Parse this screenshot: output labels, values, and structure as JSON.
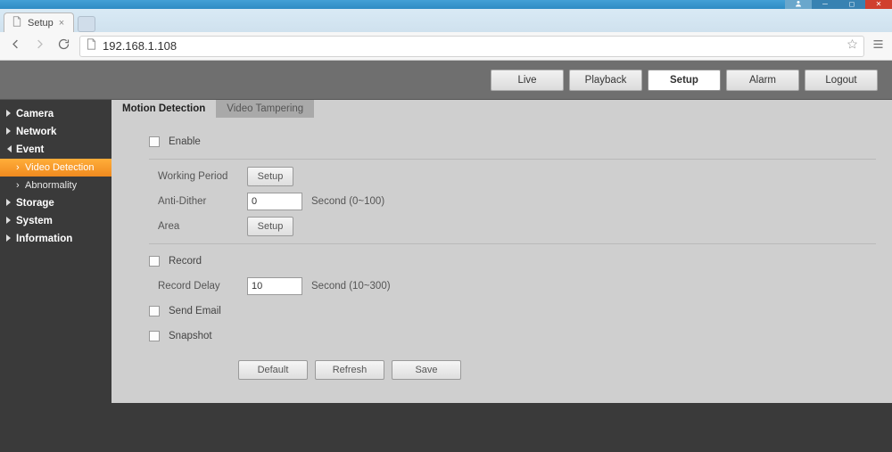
{
  "browser": {
    "tab_title": "Setup",
    "url": "192.168.1.108"
  },
  "topnav": {
    "live": "Live",
    "playback": "Playback",
    "setup": "Setup",
    "alarm": "Alarm",
    "logout": "Logout"
  },
  "sidebar": {
    "camera": "Camera",
    "network": "Network",
    "event": "Event",
    "video_detection": "Video Detection",
    "abnormality": "Abnormality",
    "storage": "Storage",
    "system": "System",
    "information": "Information"
  },
  "tabs": {
    "motion_detection": "Motion Detection",
    "video_tampering": "Video Tampering"
  },
  "form": {
    "enable": "Enable",
    "working_period": "Working Period",
    "setup_btn": "Setup",
    "anti_dither": "Anti-Dither",
    "anti_dither_value": "0",
    "anti_dither_hint": "Second (0~100)",
    "area": "Area",
    "record": "Record",
    "record_delay": "Record Delay",
    "record_delay_value": "10",
    "record_delay_hint": "Second (10~300)",
    "send_email": "Send Email",
    "snapshot": "Snapshot",
    "default": "Default",
    "refresh": "Refresh",
    "save": "Save"
  }
}
